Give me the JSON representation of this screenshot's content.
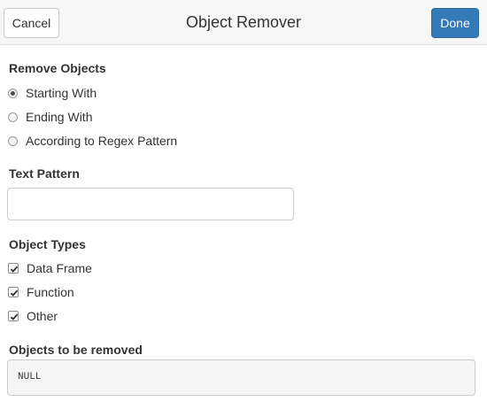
{
  "header": {
    "title": "Object Remover",
    "cancel_label": "Cancel",
    "done_label": "Done"
  },
  "remove_objects": {
    "label": "Remove Objects",
    "options": [
      {
        "label": "Starting With",
        "selected": true
      },
      {
        "label": "Ending With",
        "selected": false
      },
      {
        "label": "According to Regex Pattern",
        "selected": false
      }
    ]
  },
  "text_pattern": {
    "label": "Text Pattern",
    "value": "",
    "placeholder": ""
  },
  "object_types": {
    "label": "Object Types",
    "options": [
      {
        "label": "Data Frame",
        "checked": true
      },
      {
        "label": "Function",
        "checked": true
      },
      {
        "label": "Other",
        "checked": true
      }
    ]
  },
  "objects_to_remove": {
    "label": "Objects to be removed",
    "value": "NULL"
  },
  "colors": {
    "primary": "#337ab7",
    "header_bg": "#f6f6f6"
  }
}
